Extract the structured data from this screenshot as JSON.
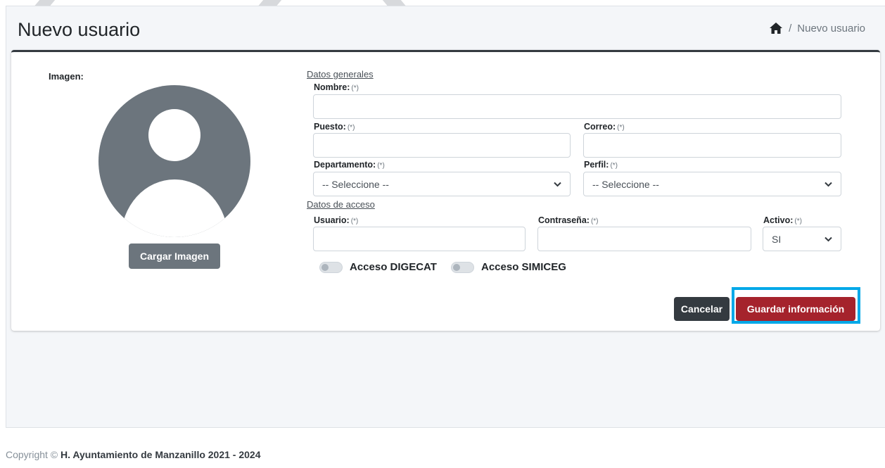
{
  "header": {
    "title": "Nuevo usuario",
    "breadcrumb_current": "Nuevo usuario",
    "breadcrumb_separator": "/"
  },
  "image_section": {
    "label": "Imagen:",
    "load_button": "Cargar Imagen"
  },
  "general": {
    "section_label": "Datos generales",
    "nombre_label": "Nombre:",
    "puesto_label": "Puesto:",
    "correo_label": "Correo:",
    "departamento_label": "Departamento:",
    "departamento_value": "-- Seleccione --",
    "perfil_label": "Perfil:",
    "perfil_value": "-- Seleccione --",
    "required_mark": "(*)"
  },
  "access": {
    "section_label": "Datos de acceso",
    "usuario_label": "Usuario:",
    "contrasena_label": "Contraseña:",
    "activo_label": "Activo:",
    "activo_value": "SI",
    "toggle_digecat": "Acceso DIGECAT",
    "toggle_simiceg": "Acceso SIMICEG"
  },
  "actions": {
    "cancel": "Cancelar",
    "save": "Guardar información"
  },
  "footer": {
    "prefix": "Copyright ©",
    "org": "H. Ayuntamiento de Manzanillo 2021 - 2024"
  },
  "colors": {
    "save": "#a5232c",
    "cancel": "#343a40",
    "highlight": "#00a8e8",
    "avatar": "#6c757d"
  }
}
